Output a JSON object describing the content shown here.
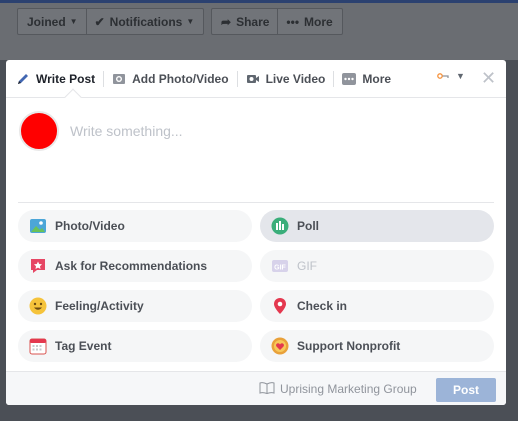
{
  "page_bar": {
    "joined_label": "Joined",
    "notifications_label": "Notifications",
    "share_label": "Share",
    "more_label": "More"
  },
  "composer": {
    "tabs": [
      {
        "label": "Write Post",
        "icon": "pencil-icon",
        "active": true
      },
      {
        "label": "Add Photo/Video",
        "icon": "camera-icon",
        "active": false
      },
      {
        "label": "Live Video",
        "icon": "video-camera-icon",
        "active": false
      },
      {
        "label": "More",
        "icon": "more-dots-icon",
        "active": false
      }
    ],
    "placeholder": "Write something...",
    "avatar_color": "#ff0000",
    "options": [
      {
        "label": "Photo/Video",
        "icon": "photo-icon"
      },
      {
        "label": "Poll",
        "icon": "poll-icon"
      },
      {
        "label": "Ask for Recommendations",
        "icon": "recommendation-icon"
      },
      {
        "label": "GIF",
        "icon": "gif-icon"
      },
      {
        "label": "Feeling/Activity",
        "icon": "smiley-icon"
      },
      {
        "label": "Check in",
        "icon": "location-pin-icon"
      },
      {
        "label": "Tag Event",
        "icon": "calendar-icon"
      },
      {
        "label": "Support Nonprofit",
        "icon": "donate-icon"
      }
    ],
    "footer": {
      "group_name": "Uprising Marketing Group",
      "post_label": "Post"
    }
  },
  "colors": {
    "accent": "#4267b2",
    "post_button": "#9cb4d8",
    "overlay": "#4b4f56"
  }
}
